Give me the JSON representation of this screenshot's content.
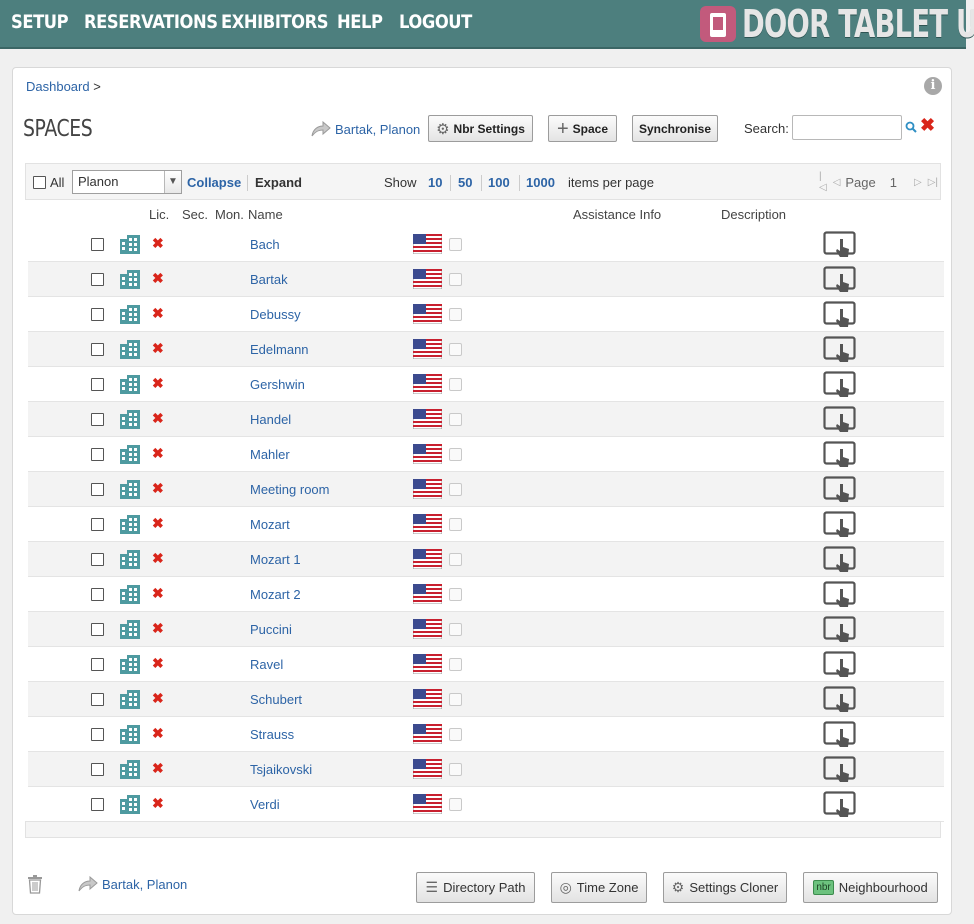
{
  "nav": {
    "items": [
      "SETUP",
      "RESERVATIONS",
      "EXHIBITORS",
      "HELP",
      "LOGOUT"
    ],
    "logo_text": "DOOR TABLET UI"
  },
  "breadcrumb": {
    "home": "Dashboard",
    "separator": ">"
  },
  "page": {
    "title": "SPACES"
  },
  "header_actions": {
    "share_link": "Bartak, Planon",
    "nbr_settings": "Nbr Settings",
    "add_space": "Space",
    "synchronise": "Synchronise",
    "search_label": "Search:",
    "search_value": ""
  },
  "toolbar": {
    "all_label": "All",
    "filter_selected": "Planon",
    "collapse": "Collapse",
    "expand": "Expand",
    "show": "Show",
    "page_sizes": [
      "10",
      "50",
      "100",
      "1000"
    ],
    "items_per_page": "items per page",
    "page_label": "Page",
    "page_number": "1"
  },
  "table": {
    "columns": {
      "lic": "Lic.",
      "sec": "Sec.",
      "mon": "Mon.",
      "name": "Name",
      "assistance": "Assistance Info",
      "description": "Description"
    },
    "rows": [
      "Bach",
      "Bartak",
      "Debussy",
      "Edelmann",
      "Gershwin",
      "Handel",
      "Mahler",
      "Meeting room",
      "Mozart",
      "Mozart 1",
      "Mozart 2",
      "Puccini",
      "Ravel",
      "Schubert",
      "Strauss",
      "Tsjaikovski",
      "Verdi"
    ]
  },
  "footer": {
    "share_link": "Bartak, Planon",
    "directory_path": "Directory Path",
    "time_zone": "Time Zone",
    "settings_cloner": "Settings Cloner",
    "neighbourhood_badge": "nbr",
    "neighbourhood": "Neighbourhood"
  },
  "colors": {
    "nav_bg": "#4d7f7e",
    "link": "#2d64a6",
    "delete_red": "#d9251a",
    "building_icon": "#4e9aa0"
  }
}
